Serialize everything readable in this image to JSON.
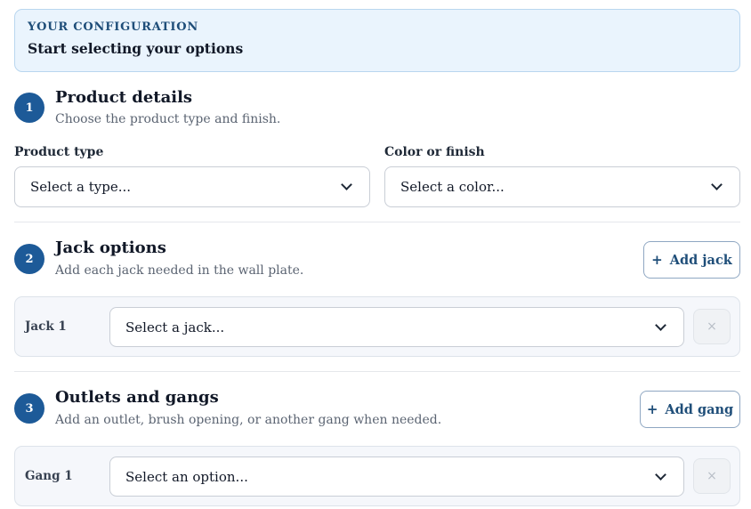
{
  "banner": {
    "eyebrow": "YOUR CONFIGURATION",
    "title": "Start selecting your options"
  },
  "sections": [
    {
      "step": "1",
      "title": "Product details",
      "description": "Choose the product type and finish."
    },
    {
      "step": "2",
      "title": "Jack options",
      "description": "Add each jack needed in the wall plate.",
      "add_label": "Add jack",
      "add_icon": "+"
    },
    {
      "step": "3",
      "title": "Outlets and gangs",
      "description": "Add an outlet, brush opening, or another gang when needed.",
      "add_label": "Add gang",
      "add_icon": "+"
    }
  ],
  "product": {
    "type_label": "Product type",
    "type_value": "Select a type...",
    "color_label": "Color or finish",
    "color_value": "Select a color..."
  },
  "jacks": [
    {
      "label": "Jack 1",
      "value": "Select a jack...",
      "remove_icon": "×"
    }
  ],
  "gangs": [
    {
      "label": "Gang 1",
      "value": "Select an option...",
      "remove_icon": "×"
    }
  ],
  "colors": {
    "accent": "#1d5a98",
    "banner_bg": "#eaf4fd",
    "card_bg": "#f5f7fb"
  }
}
